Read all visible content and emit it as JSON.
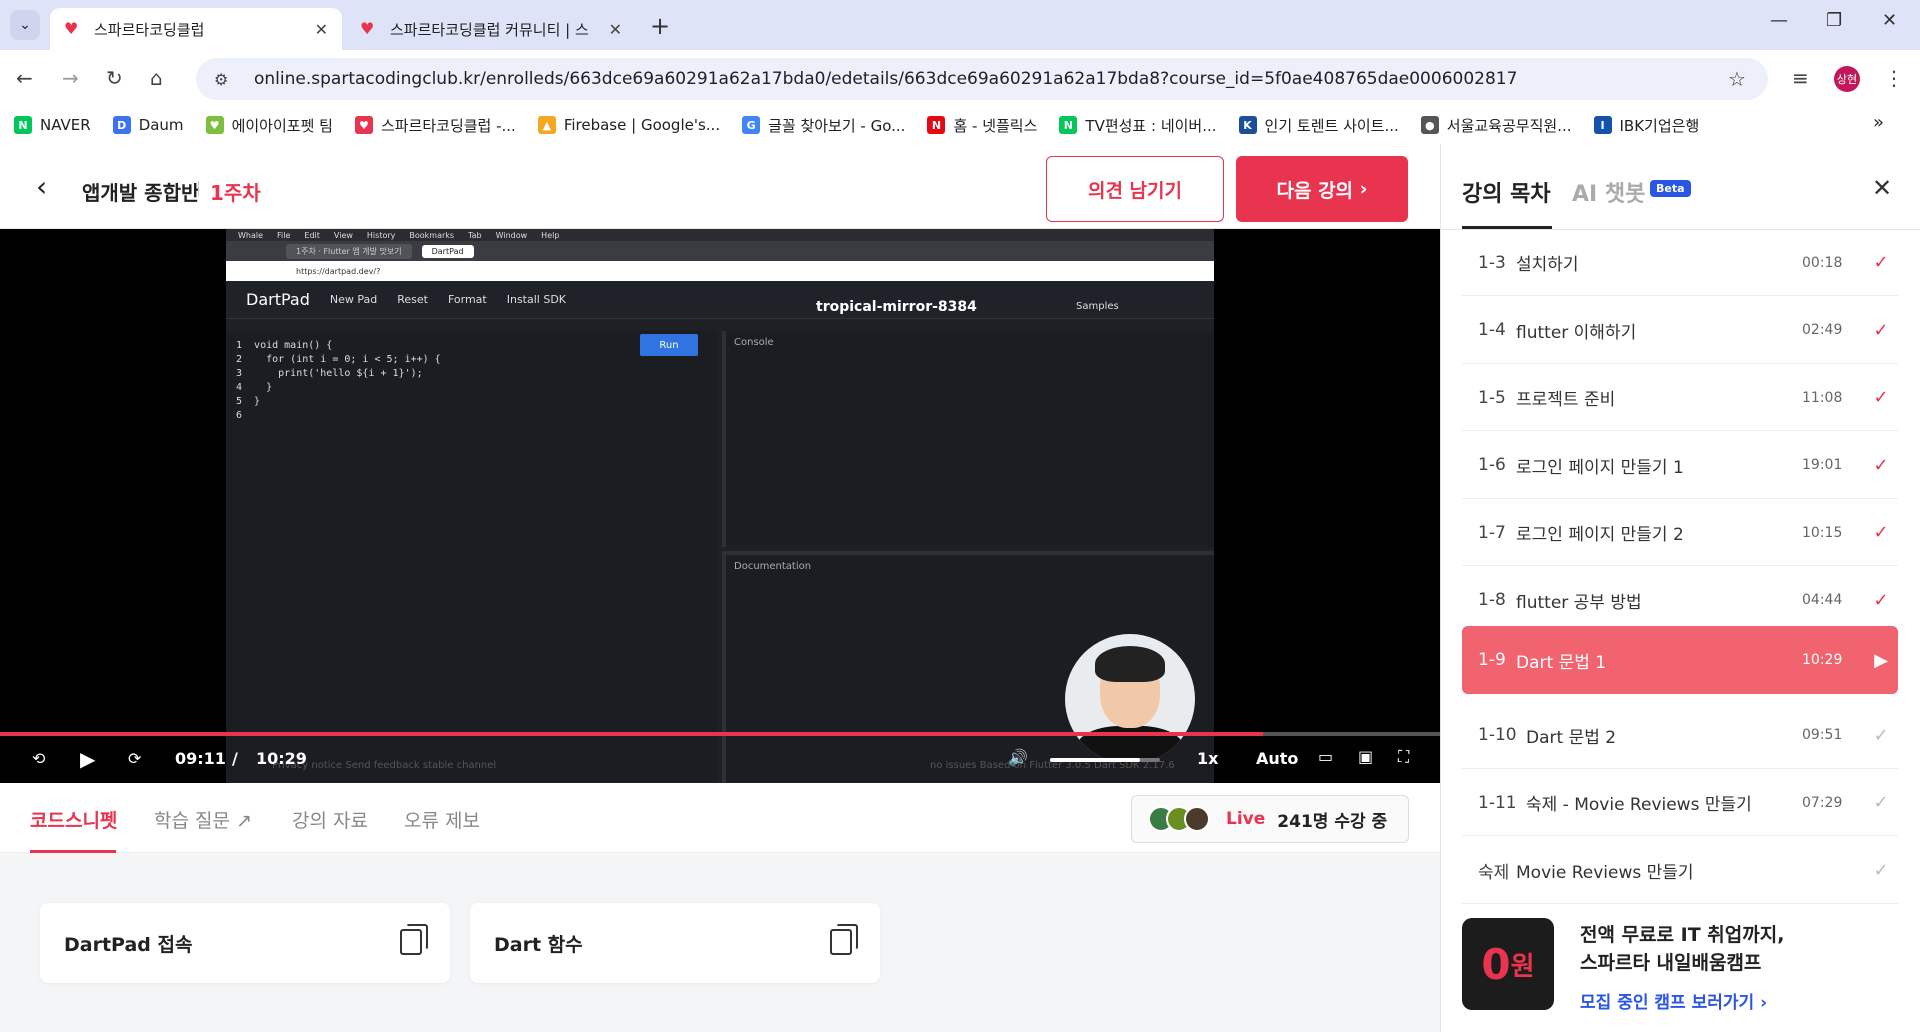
{
  "browser": {
    "tabs": [
      {
        "title": "스파르타코딩클럽",
        "active": true
      },
      {
        "title": "스파르타코딩클럽 커뮤니티 | 스",
        "active": false
      }
    ],
    "url": "online.spartacodingclub.kr/enrolleds/663dce69a60291a62a17bda0/edetails/663dce69a60291a62a17bda8?course_id=5f0ae408765dae0006002817",
    "profile_initials": "상현",
    "bookmarks": [
      {
        "label": "NAVER",
        "color": "#03c75a",
        "glyph": "N"
      },
      {
        "label": "Daum",
        "color": "#3b73f0",
        "glyph": "D"
      },
      {
        "label": "에이아이포펫 팀",
        "color": "#7fbf3f",
        "glyph": "♥"
      },
      {
        "label": "스파르타코딩클럽 -...",
        "color": "#e8344e",
        "glyph": "♥"
      },
      {
        "label": "Firebase | Google's...",
        "color": "#f5a623",
        "glyph": "▲"
      },
      {
        "label": "글꼴 찾아보기 - Go...",
        "color": "#4285f4",
        "glyph": "G"
      },
      {
        "label": "홈 - 넷플릭스",
        "color": "#e50914",
        "glyph": "N"
      },
      {
        "label": "TV편성표 : 네이버...",
        "color": "#03c75a",
        "glyph": "N"
      },
      {
        "label": "인기 토렌트 사이트...",
        "color": "#1a4f9c",
        "glyph": "K"
      },
      {
        "label": "서울교육공무직원...",
        "color": "#555555",
        "glyph": "●"
      },
      {
        "label": "IBK기업은행",
        "color": "#1453a8",
        "glyph": "I"
      }
    ]
  },
  "header": {
    "course": "앱개발 종합반",
    "week": "1주차",
    "feedback_button": "의견 남기기",
    "next_button": "다음 강의"
  },
  "video": {
    "dartpad": {
      "menubar": [
        "Whale",
        "File",
        "Edit",
        "View",
        "History",
        "Bookmarks",
        "Tab",
        "Window",
        "Help"
      ],
      "tab1": "1주차 · Flutter 앱 개발 맛보기",
      "tab2": "DartPad",
      "url": "https://dartpad.dev/?",
      "logo": "DartPad",
      "actions": [
        "New Pad",
        "Reset",
        "Format",
        "Install SDK"
      ],
      "title": "tropical-mirror-8384",
      "samples": "Samples",
      "run": "Run",
      "console": "Console",
      "documentation": "Documentation",
      "code": "1  void main() {\n2    for (int i = 0; i < 5; i++) {\n3      print('hello ${i + 1}');\n4    }\n5  }\n6",
      "footer_left": "Privacy notice    Send feedback    stable channel",
      "footer_right": "no issues    Based on Flutter 3.0.5 Dart SDK 2.17.6"
    },
    "current_time": "09:11",
    "separator": "/",
    "total_time": "10:29",
    "progress": 0.877,
    "volume": 0.82,
    "speed": "1x",
    "quality": "Auto"
  },
  "lesson_tabs": [
    {
      "label": "코드스니펫",
      "active": true
    },
    {
      "label": "학습 질문",
      "active": false
    },
    {
      "label": "강의 자료",
      "active": false
    },
    {
      "label": "오류 제보",
      "active": false
    }
  ],
  "live": {
    "label": "Live",
    "count": "241명 수강 중"
  },
  "snippets": [
    {
      "title": "DartPad 접속"
    },
    {
      "title": "Dart 함수"
    }
  ],
  "sidebar": {
    "title": "강의 목차",
    "ai_tab": "AI 챗봇",
    "beta": "Beta",
    "lessons": [
      {
        "num": "1-3",
        "title": "설치하기",
        "duration": "00:18",
        "state": "done"
      },
      {
        "num": "1-4",
        "title": "flutter 이해하기",
        "duration": "02:49",
        "state": "done"
      },
      {
        "num": "1-5",
        "title": "프로젝트 준비",
        "duration": "11:08",
        "state": "done"
      },
      {
        "num": "1-6",
        "title": "로그인 페이지 만들기 1",
        "duration": "19:01",
        "state": "done"
      },
      {
        "num": "1-7",
        "title": "로그인 페이지 만들기 2",
        "duration": "10:15",
        "state": "done"
      },
      {
        "num": "1-8",
        "title": "flutter 공부 방법",
        "duration": "04:44",
        "state": "done"
      },
      {
        "num": "1-9",
        "title": "Dart 문법 1",
        "duration": "10:29",
        "state": "current"
      },
      {
        "num": "1-10",
        "title": "Dart 문법 2",
        "duration": "09:51",
        "state": "todo"
      },
      {
        "num": "1-11",
        "title": "숙제 - Movie Reviews 만들기",
        "duration": "07:29",
        "state": "todo"
      },
      {
        "num": "숙제",
        "title": "Movie Reviews 만들기",
        "duration": "",
        "state": "todo"
      }
    ],
    "promo": {
      "logo_main": "0",
      "logo_sub": "원",
      "line1": "전액 무료로 IT 취업까지,",
      "line2": "스파르타 내일배움캠프",
      "link": "모집 중인 캠프 보러가기"
    }
  }
}
